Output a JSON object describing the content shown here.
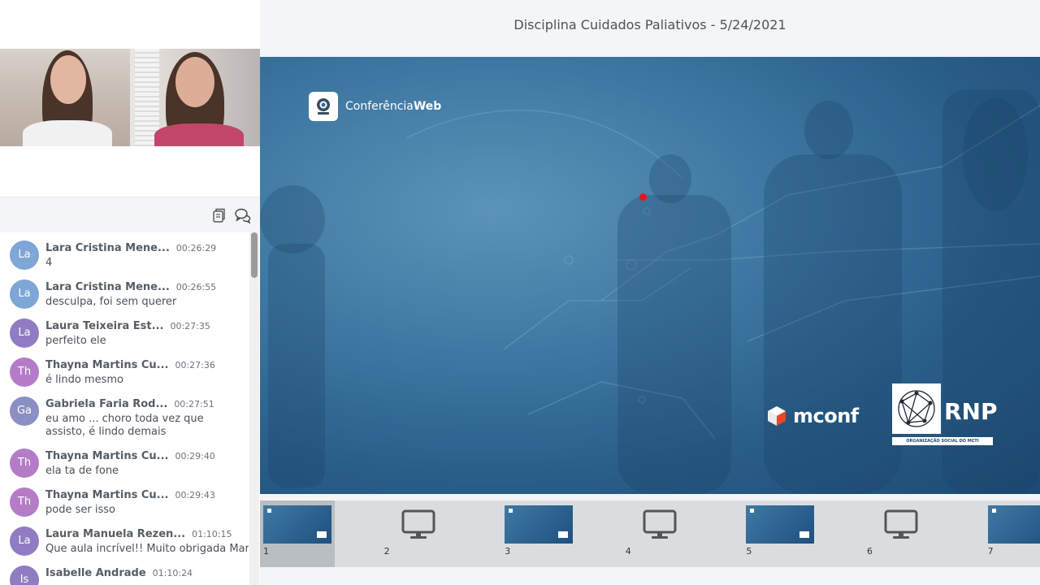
{
  "meeting": {
    "title": "Disciplina Cuidados Paliativos - 5/24/2021"
  },
  "slide": {
    "logo_text_a": "Conferência",
    "logo_text_b": "Web",
    "mconf_text": "mconf",
    "rnp_text": "RNP",
    "rnp_sub": "ORGANIZAÇÃO SOCIAL DO MCTI"
  },
  "chat": {
    "header_icons": [
      "copy-icon",
      "chat-bubbles-icon"
    ],
    "messages": [
      {
        "initials": "La",
        "color": "#7ea6d6",
        "name": "Lara Cristina Mene...",
        "time": "00:26:29",
        "lines": [
          "4"
        ]
      },
      {
        "initials": "La",
        "color": "#7ea6d6",
        "name": "Lara Cristina Mene...",
        "time": "00:26:55",
        "lines": [
          "desculpa, foi sem querer"
        ]
      },
      {
        "initials": "La",
        "color": "#8f7cc2",
        "name": "Laura Teixeira Est...",
        "time": "00:27:35",
        "lines": [
          "perfeito ele"
        ]
      },
      {
        "initials": "Th",
        "color": "#b47cc7",
        "name": "Thayna Martins Cu...",
        "time": "00:27:36",
        "lines": [
          "é lindo mesmo"
        ]
      },
      {
        "initials": "Ga",
        "color": "#8c8fc2",
        "name": "Gabriela Faria Rod...",
        "time": "00:27:51",
        "lines": [
          "eu amo ... choro toda vez que",
          "assisto, é lindo demais"
        ]
      },
      {
        "initials": "Th",
        "color": "#b47cc7",
        "name": "Thayna Martins Cu...",
        "time": "00:29:40",
        "lines": [
          "ela ta de fone"
        ]
      },
      {
        "initials": "Th",
        "color": "#b47cc7",
        "name": "Thayna Martins Cu...",
        "time": "00:29:43",
        "lines": [
          "pode ser isso"
        ]
      },
      {
        "initials": "La",
        "color": "#8f7cc2",
        "name": "Laura Manuela Rezen...",
        "time": "01:10:15",
        "lines": [
          "Que aula incrível!! Muito obrigada Mar"
        ]
      },
      {
        "initials": "Is",
        "color": "#8f7cc2",
        "name": "Isabelle Andrade",
        "time": "01:10:24",
        "lines": []
      }
    ]
  },
  "thumbnails": [
    {
      "num": "1",
      "kind": "slide",
      "selected": true
    },
    {
      "num": "2",
      "kind": "screen",
      "selected": false
    },
    {
      "num": "3",
      "kind": "slide",
      "selected": false
    },
    {
      "num": "4",
      "kind": "screen",
      "selected": false
    },
    {
      "num": "5",
      "kind": "slide",
      "selected": false
    },
    {
      "num": "6",
      "kind": "screen",
      "selected": false
    },
    {
      "num": "7",
      "kind": "slide",
      "selected": false
    }
  ]
}
